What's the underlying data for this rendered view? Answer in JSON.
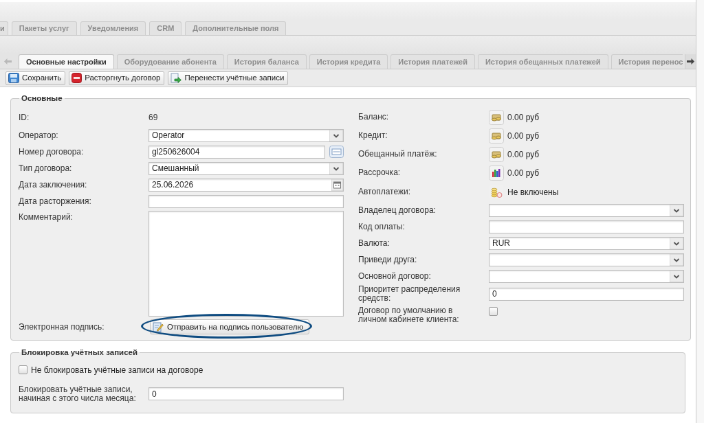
{
  "top_tabs": [
    {
      "label": "и",
      "selected": false
    },
    {
      "label": "Пакеты услуг",
      "selected": false
    },
    {
      "label": "Уведомления",
      "selected": false
    },
    {
      "label": "CRM",
      "selected": false
    },
    {
      "label": "Дополнительные поля",
      "selected": false
    }
  ],
  "contract_tabs": [
    {
      "label": "Основные настройки",
      "selected": true
    },
    {
      "label": "Оборудование абонента",
      "selected": false
    },
    {
      "label": "История баланса",
      "selected": false
    },
    {
      "label": "История кредита",
      "selected": false
    },
    {
      "label": "История платежей",
      "selected": false
    },
    {
      "label": "История обещанных платежей",
      "selected": false
    },
    {
      "label": "История перенос",
      "selected": false
    }
  ],
  "toolbar": [
    {
      "kind": "save",
      "label": "Сохранить"
    },
    {
      "kind": "terminate",
      "label": "Расторгнуть договор"
    },
    {
      "kind": "transfer",
      "label": "Перенести учётные записи"
    }
  ],
  "main_section": {
    "legend": "Основные",
    "left_fields": [
      {
        "kind": "static",
        "label": "ID:",
        "value": "69"
      },
      {
        "kind": "select",
        "label": "Оператор:",
        "value": "Operator"
      },
      {
        "kind": "lookup",
        "label": "Номер договора:",
        "value": "gl250626004"
      },
      {
        "kind": "select",
        "label": "Тип договора:",
        "value": "Смешанный"
      },
      {
        "kind": "date",
        "label": "Дата заключения:",
        "value": "25.06.2026"
      },
      {
        "kind": "input",
        "label": "Дата расторжения:"
      },
      {
        "kind": "textarea",
        "label": "Комментарий:"
      },
      {
        "kind": "action",
        "label": "Электронная подпись:",
        "button": "Отправить на подпись пользователю",
        "highlighted": true
      }
    ],
    "right_fields": [
      {
        "kind": "money",
        "label": "Баланс:",
        "value": "0.00 руб"
      },
      {
        "kind": "money",
        "label": "Кредит:",
        "value": "0.00 руб"
      },
      {
        "kind": "money",
        "label": "Обещанный платёж:",
        "value": "0.00 руб"
      },
      {
        "kind": "installment",
        "label": "Рассрочка:",
        "value": "0.00 руб"
      },
      {
        "kind": "autopay",
        "label": "Автоплатежи:",
        "value": "Не включены"
      },
      {
        "kind": "select",
        "label": "Владелец договора:"
      },
      {
        "kind": "input",
        "label": "Код оплаты:"
      },
      {
        "kind": "select",
        "label": "Валюта:",
        "value": "RUR"
      },
      {
        "kind": "select",
        "label": "Приведи друга:"
      },
      {
        "kind": "select",
        "label": "Основной договор:"
      },
      {
        "kind": "input",
        "label": "Приоритет распределения средств:",
        "value": "0"
      },
      {
        "kind": "checkbox",
        "label": "Договор по умолчанию в личном кабинете клиента:",
        "checked": false
      }
    ]
  },
  "blocking_section": {
    "legend": "Блокировка учётных записей",
    "no_block": {
      "label": "Не блокировать учётные записи на договоре",
      "checked": false
    },
    "block_from_day": {
      "label": "Блокировать учётные записи, начиная с этого числа месяца:",
      "value": "0"
    }
  }
}
